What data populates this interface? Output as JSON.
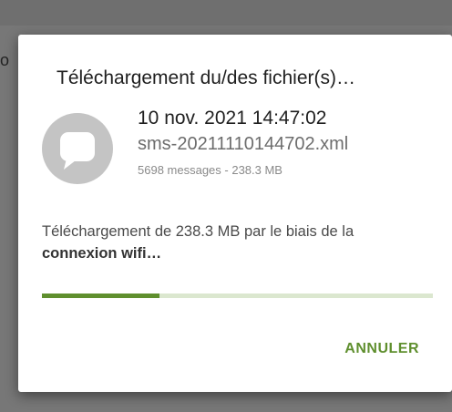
{
  "dialog": {
    "title": "Téléchargement du/des fichier(s)…",
    "file": {
      "date": "10 nov. 2021 14:47:02",
      "name": "sms-20211110144702.xml",
      "meta": "5698 messages - 238.3 MB",
      "icon": "chat-bubble-icon"
    },
    "status_text": "Téléchargement de 238.3 MB par le biais de la",
    "status_text_bold": "connexion wifi…",
    "progress": 0.3,
    "cancel_label": "ANNULER"
  },
  "background": {
    "edge_char": "o"
  },
  "colors": {
    "accent": "#5f8f2e",
    "track": "#dbe7cf",
    "avatar": "#c4c4c4"
  }
}
